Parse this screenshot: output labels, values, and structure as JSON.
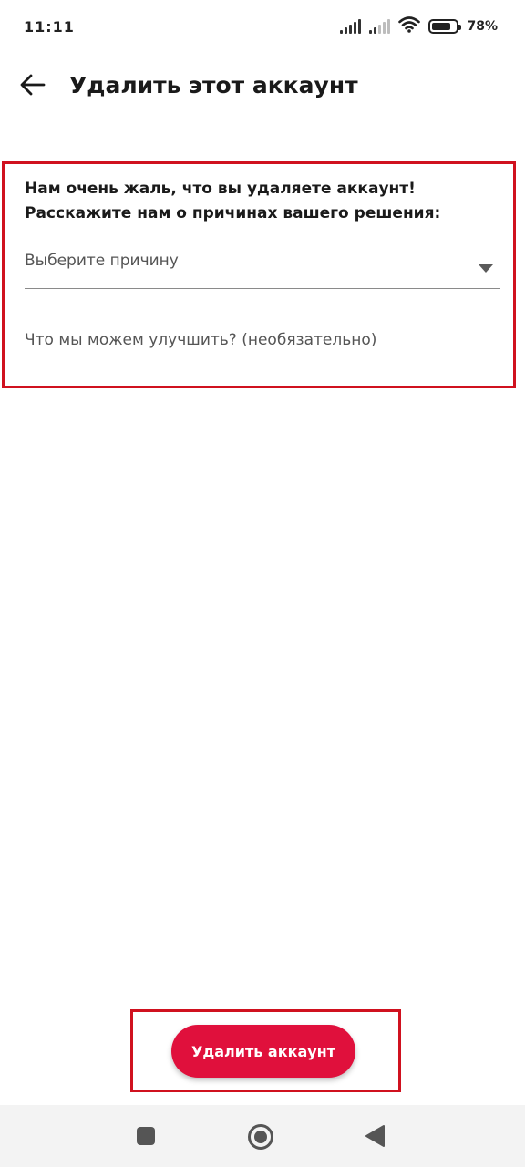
{
  "status_bar": {
    "time": "11:11",
    "battery_percent": "78%",
    "battery_level": 0.78,
    "icons": [
      "signal-icon",
      "signal-icon",
      "wifi-icon",
      "battery-icon"
    ]
  },
  "header": {
    "back_icon": "arrow-left-icon",
    "title": "Удалить этот аккаунт"
  },
  "form": {
    "intro": "Нам очень жаль, что вы удаляете аккаунт! Расскажите нам о причинах вашего решения:",
    "reason_select": {
      "placeholder": "Выберите причину",
      "icon": "dropdown-arrow-icon"
    },
    "improve_field": {
      "placeholder": "Что мы можем улучшить? (необязательно)",
      "value": ""
    }
  },
  "actions": {
    "delete_label": "Удалить аккаунт"
  },
  "nav_bar": {
    "icons": [
      "recent-apps-icon",
      "home-icon",
      "back-icon"
    ]
  },
  "colors": {
    "accent": "#e0103c",
    "highlight_border": "#d0111f"
  }
}
